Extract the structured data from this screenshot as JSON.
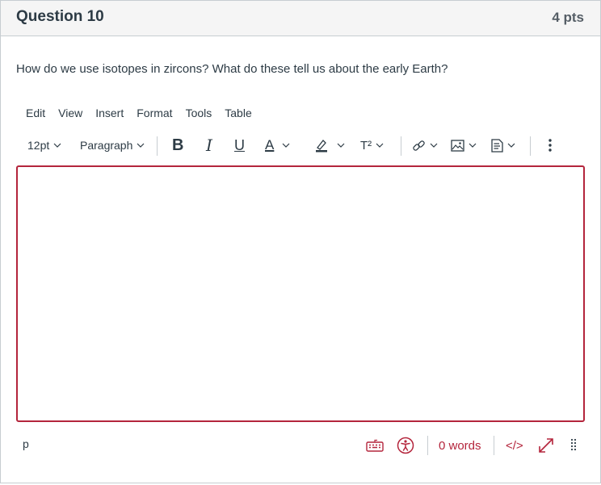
{
  "question": {
    "title": "Question 10",
    "points": "4 pts",
    "text": "How do we use isotopes in zircons? What do these tell us about the early Earth?"
  },
  "menubar": {
    "items": [
      "Edit",
      "View",
      "Insert",
      "Format",
      "Tools",
      "Table"
    ]
  },
  "toolbar": {
    "font_size": "12pt",
    "block_format": "Paragraph",
    "bold": "B",
    "italic": "I",
    "underline": "U",
    "text_color": "A",
    "superscript": "T²"
  },
  "statusbar": {
    "path": "p",
    "word_count": "0 words",
    "html_toggle": "</>"
  },
  "colors": {
    "accent": "#b4253c",
    "text": "#2d3b45",
    "border": "#c7cdd1",
    "header_bg": "#f5f5f5"
  }
}
